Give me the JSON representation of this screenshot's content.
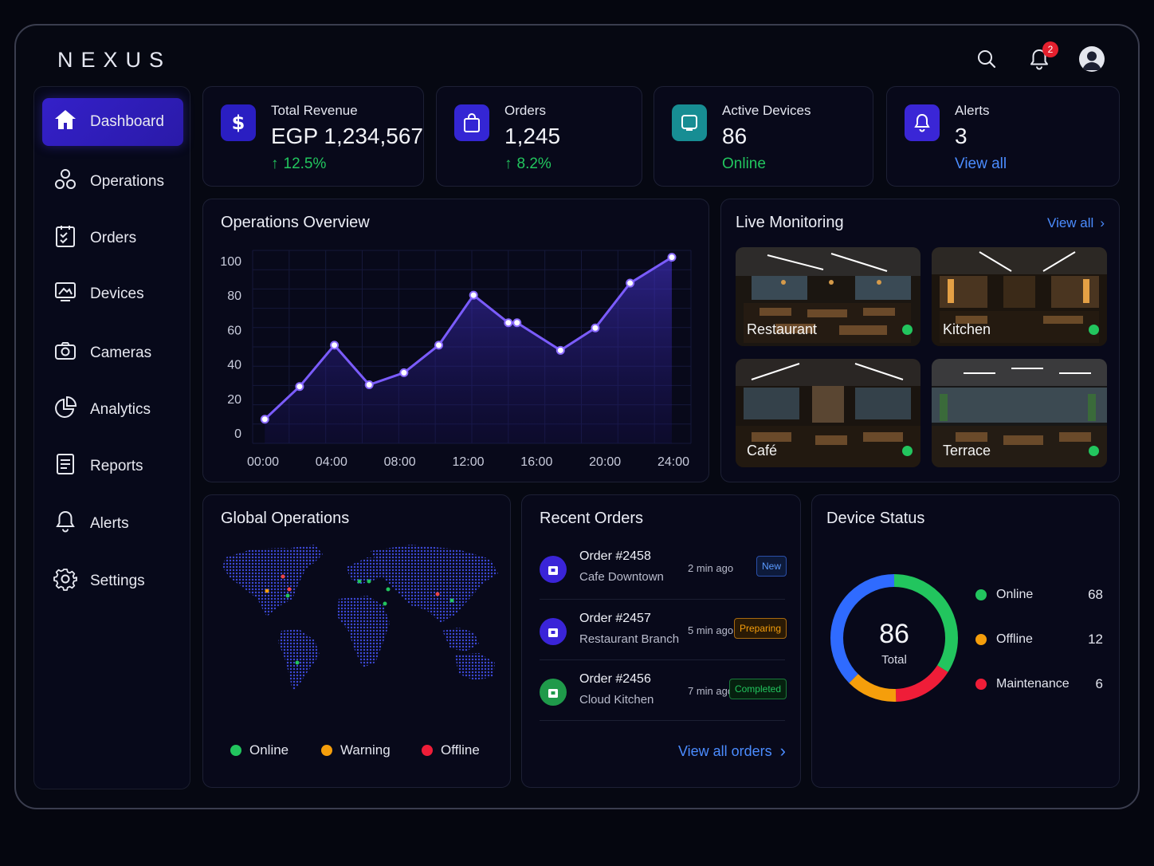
{
  "app": {
    "logo": "NEXUS"
  },
  "header": {
    "notification_count": "2"
  },
  "sidebar": {
    "items": [
      {
        "label": "Dashboard",
        "icon": "home-icon"
      },
      {
        "label": "Operations",
        "icon": "operations-icon"
      },
      {
        "label": "Orders",
        "icon": "clipboard-icon"
      },
      {
        "label": "Devices",
        "icon": "monitor-icon"
      },
      {
        "label": "Cameras",
        "icon": "camera-icon"
      },
      {
        "label": "Analytics",
        "icon": "pie-chart-icon"
      },
      {
        "label": "Reports",
        "icon": "document-icon"
      },
      {
        "label": "Alerts",
        "icon": "bell-icon"
      },
      {
        "label": "Settings",
        "icon": "gear-icon"
      }
    ]
  },
  "kpis": {
    "revenue": {
      "label": "Total Revenue",
      "value": "EGP 1,234,567",
      "change": "12.5%"
    },
    "orders": {
      "label": "Orders",
      "value": "1,245",
      "change": "8.2%"
    },
    "devices": {
      "label": "Active Devices",
      "value": "86",
      "status": "Online"
    },
    "alerts": {
      "label": "Alerts",
      "value": "3",
      "link": "View all"
    }
  },
  "operations_overview": {
    "title": "Operations Overview"
  },
  "chart_data": {
    "type": "area",
    "title": "Operations Overview",
    "x": [
      0,
      2,
      4,
      6,
      8,
      10,
      12,
      14,
      14.5,
      17,
      19,
      21,
      23.4
    ],
    "values": [
      8,
      27,
      51,
      28,
      35,
      51,
      80,
      64,
      64,
      48,
      61,
      87,
      102
    ],
    "xticks": [
      "00:00",
      "04:00",
      "08:00",
      "12:00",
      "16:00",
      "20:00",
      "24:00"
    ],
    "yticks": [
      "100",
      "80",
      "60",
      "40",
      "20",
      "0"
    ],
    "xlim": [
      -0.7,
      24.5
    ],
    "ylim": [
      -6,
      106
    ],
    "grid": true
  },
  "live_monitoring": {
    "title": "Live Monitoring",
    "view_all": "View all",
    "cameras": [
      "Restaurant",
      "Kitchen",
      "Café",
      "Terrace"
    ]
  },
  "global_operations": {
    "title": "Global Operations",
    "legend": [
      "Online",
      "Warning",
      "Offline"
    ]
  },
  "recent_orders": {
    "title": "Recent Orders",
    "orders": [
      {
        "id": "Order #2458",
        "place": "Cafe Downtown",
        "time": "2 min ago",
        "status": "New"
      },
      {
        "id": "Order #2457",
        "place": "Restaurant Branch",
        "time": "5 min ago",
        "status": "Preparing"
      },
      {
        "id": "Order #2456",
        "place": "Cloud Kitchen",
        "time": "7 min ago",
        "status": "Completed"
      }
    ],
    "view_all": "View all orders"
  },
  "device_status": {
    "title": "Device Status",
    "total": "86",
    "total_label": "Total",
    "rows": [
      {
        "label": "Online",
        "count": "68",
        "color": "#22c55e"
      },
      {
        "label": "Offline",
        "count": "12",
        "color": "#f59e0b"
      },
      {
        "label": "Maintenance",
        "count": "6",
        "color": "#ef1d38"
      }
    ]
  },
  "colors": {
    "accent": "#3422d0",
    "positive": "#22c55e",
    "link": "#4b8cff",
    "ring_blue": "#2f6bff"
  }
}
